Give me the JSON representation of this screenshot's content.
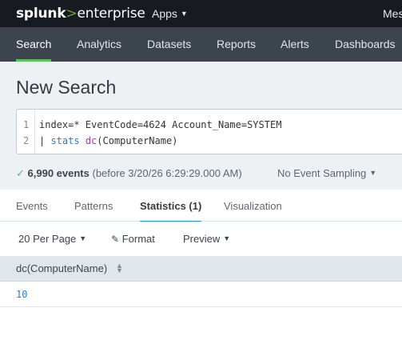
{
  "brand": {
    "prefix": "splunk",
    "arrow": ">",
    "suffix": "enterprise"
  },
  "topbar": {
    "apps_label": "Apps",
    "user_label": "Mes"
  },
  "nav": {
    "items": [
      "Search",
      "Analytics",
      "Datasets",
      "Reports",
      "Alerts",
      "Dashboards"
    ],
    "active": "Search"
  },
  "page": {
    "title": "New Search"
  },
  "query": {
    "line_numbers": [
      "1",
      "2"
    ],
    "line1": "index=* EventCode=4624 Account_Name=SYSTEM",
    "line2_pipe": "| ",
    "line2_command": "stats",
    "line2_function": "dc",
    "line2_args": "(ComputerName)"
  },
  "results_summary": {
    "check": "✓",
    "count": "6,990 events",
    "detail": "(before 3/20/26 6:29:29.000 AM)",
    "sampling_label": "No Event Sampling"
  },
  "result_tabs": {
    "items": [
      "Events",
      "Patterns",
      "Statistics (1)",
      "Visualization"
    ],
    "active": "Statistics (1)"
  },
  "toolbar": {
    "per_page": "20 Per Page",
    "format": "Format",
    "preview": "Preview"
  },
  "table": {
    "columns": [
      "dc(ComputerName)"
    ],
    "rows": [
      [
        "10"
      ]
    ]
  },
  "colors": {
    "topbar_bg": "#171a21",
    "nav_bg": "#3c444d",
    "active_nav_underline": "#5cc05c",
    "active_tab_underline": "#1a9cd8",
    "link_blue": "#1a7fd8",
    "success_green": "#5cc05c"
  },
  "icons": {
    "apps_caret": "caret-down-icon",
    "format": "pencil-icon",
    "sort": "sort-icon",
    "events_check": "check-icon"
  }
}
